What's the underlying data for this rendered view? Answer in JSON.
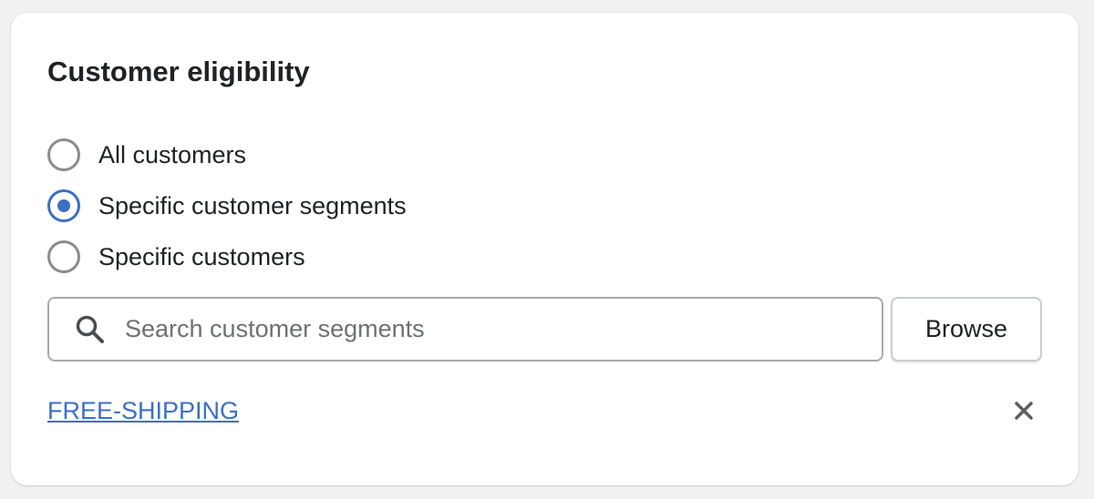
{
  "card": {
    "title": "Customer eligibility"
  },
  "eligibility_options": [
    {
      "label": "All customers",
      "checked": false
    },
    {
      "label": "Specific customer segments",
      "checked": true
    },
    {
      "label": "Specific customers",
      "checked": false
    }
  ],
  "search": {
    "placeholder": "Search customer segments",
    "value": "",
    "icon": "search-icon"
  },
  "browse": {
    "label": "Browse"
  },
  "selected_segments": [
    {
      "label": "FREE-SHIPPING",
      "remove_icon": "close-icon"
    }
  ],
  "colors": {
    "accent": "#3d6fc4",
    "text": "#202223",
    "border": "#a9aaac",
    "background": "#f1f1f1",
    "card": "#ffffff"
  }
}
